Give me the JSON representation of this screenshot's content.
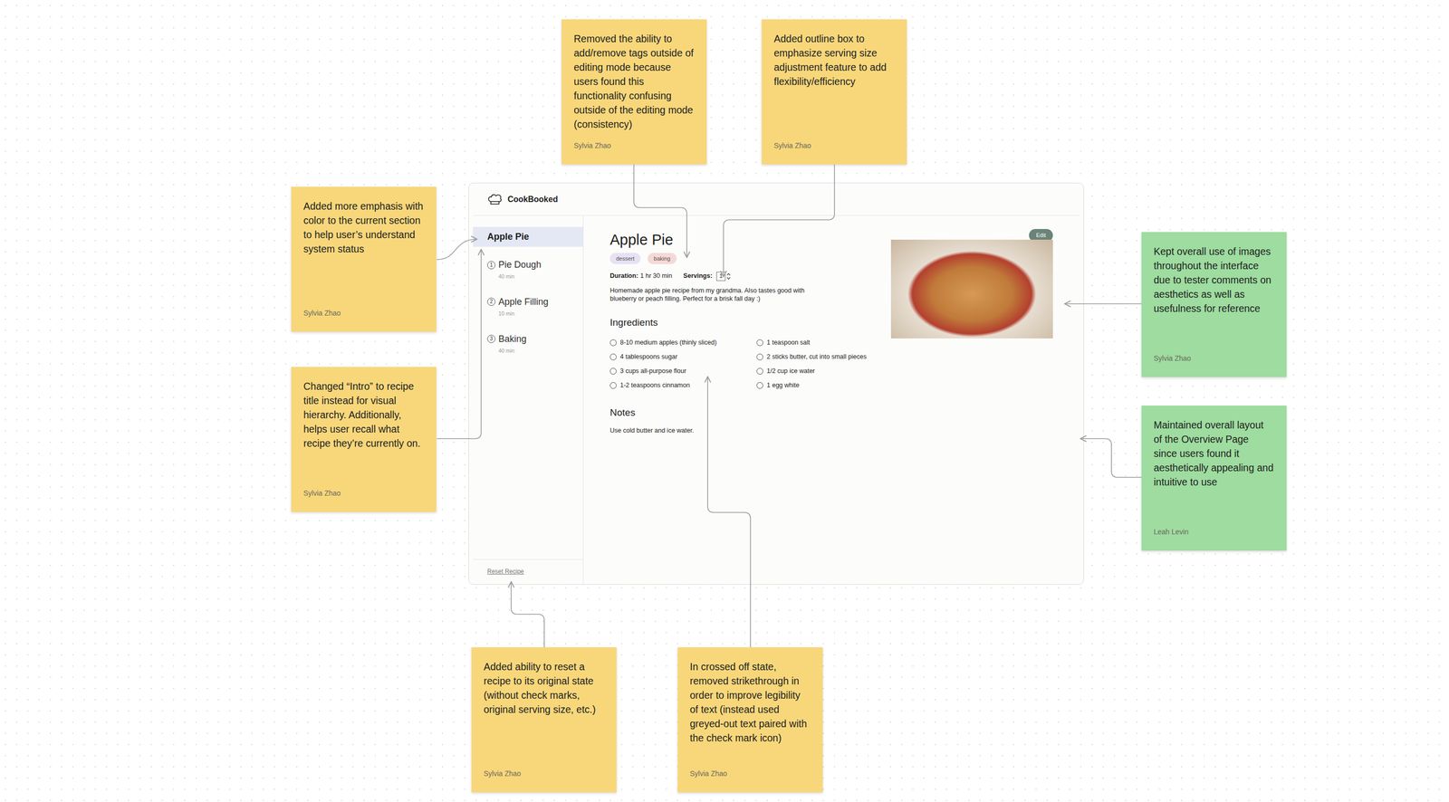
{
  "app": {
    "name": "CookBooked"
  },
  "sidebar": {
    "items": [
      {
        "kind": "intro",
        "label": "Apple Pie",
        "selected": true
      },
      {
        "kind": "step",
        "number": "1",
        "label": "Pie Dough",
        "time": "40 min",
        "selected": false
      },
      {
        "kind": "step",
        "number": "2",
        "label": "Apple Filling",
        "time": "10 min",
        "selected": false
      },
      {
        "kind": "step",
        "number": "3",
        "label": "Baking",
        "time": "40 min",
        "selected": false
      }
    ],
    "reset": "Reset Recipe"
  },
  "recipe": {
    "title": "Apple Pie",
    "edit": "Edit",
    "tags": [
      {
        "label": "dessert",
        "color": "#e7e1f4"
      },
      {
        "label": "baking",
        "color": "#f5d9d7"
      }
    ],
    "duration_label": "Duration:",
    "duration": "1 hr 30 min",
    "servings_label": "Servings:",
    "servings": "1",
    "description": "Homemade apple pie recipe from my grandma. Also tastes good with blueberry or peach filling. Perfect for a brisk fall day :)",
    "ingredients_title": "Ingredients",
    "ingredients": [
      {
        "text": "8-10 medium apples (thinly sliced)",
        "checked": false
      },
      {
        "text": "4 tablespoons sugar",
        "checked": false
      },
      {
        "text": "3 cups all-purpose flour",
        "checked": false
      },
      {
        "text": "1-2 teaspoons cinnamon",
        "checked": false
      },
      {
        "text": "1 teaspoon salt",
        "checked": false
      },
      {
        "text": "2 sticks butter, cut into small pieces",
        "checked": false
      },
      {
        "text": "1/2 cup ice water",
        "checked": false
      },
      {
        "text": "1 egg white",
        "checked": false
      }
    ],
    "notes_title": "Notes",
    "notes": "Use cold butter and ice water."
  },
  "stickies": [
    {
      "text": "Removed the ability to add/remove tags outside of editing mode because users found this functionality confusing outside of the editing mode (consistency)",
      "author": "Sylvia Zhao",
      "color": "#f8d77b"
    },
    {
      "text": "Added outline box to emphasize serving size adjustment feature to add flexibility/efficiency",
      "author": "Sylvia Zhao",
      "color": "#f8d77b"
    },
    {
      "text": "Added more emphasis with color to the current section to help user’s understand system status",
      "author": "Sylvia Zhao",
      "color": "#f8d77b"
    },
    {
      "text": "Changed “Intro” to recipe title instead for visual hierarchy. Additionally, helps user recall what recipe they’re currently on.",
      "author": "Sylvia Zhao",
      "color": "#f8d77b"
    },
    {
      "text": "Kept overall use of images throughout the interface due to tester comments on aesthetics as well as usefulness for reference",
      "author": "Sylvia Zhao",
      "color": "#9edca0"
    },
    {
      "text": "Maintained overall layout of the Overview Page since users found it aesthetically appealing and intuitive to use",
      "author": "Leah Levin",
      "color": "#9edca0"
    },
    {
      "text": "Added ability to reset a recipe to its original state (without check marks, original serving size, etc.)",
      "author": "Sylvia Zhao",
      "color": "#f8d77b"
    },
    {
      "text": "In crossed off state, removed strikethrough in order to improve legibility of text (instead used greyed-out text paired with the check mark icon)",
      "author": "Sylvia Zhao",
      "color": "#f8d77b"
    }
  ]
}
